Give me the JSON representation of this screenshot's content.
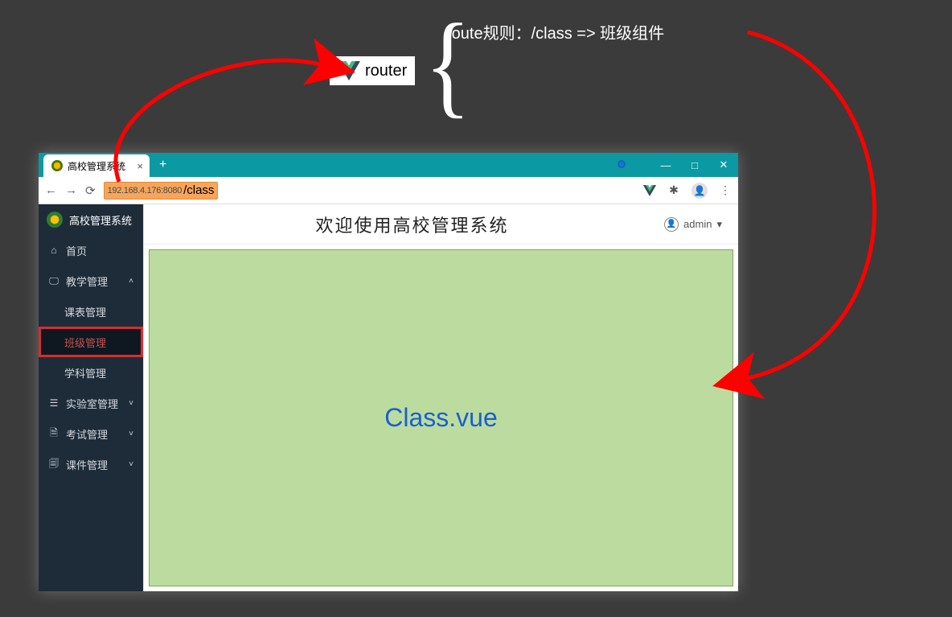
{
  "annotation": {
    "route_rule": "route规则：/class =>  班级组件",
    "router_label": "router"
  },
  "browser": {
    "tab_title": "高校管理系统",
    "new_tab": "+",
    "win_min": "—",
    "win_max": "□",
    "win_close": "✕",
    "url_host": "192.168.4.176:8080",
    "url_path": "/class",
    "menu_dots": "⋮"
  },
  "app": {
    "brand": "高校管理系统",
    "header_title": "欢迎使用高校管理系统",
    "user_name": "admin",
    "content_label": "Class.vue"
  },
  "sidebar": {
    "items": [
      {
        "icon": "⌂",
        "label": "首页",
        "chev": ""
      },
      {
        "icon": "🖵",
        "label": "教学管理",
        "chev": "˄"
      },
      {
        "icon": "",
        "label": "课表管理",
        "chev": "",
        "sub": true
      },
      {
        "icon": "",
        "label": "班级管理",
        "chev": "",
        "sub": true,
        "selected": true
      },
      {
        "icon": "",
        "label": "学科管理",
        "chev": "",
        "sub": true
      },
      {
        "icon": "☰",
        "label": "实验室管理",
        "chev": "˅"
      },
      {
        "icon": "🗎",
        "label": "考试管理",
        "chev": "˅"
      },
      {
        "icon": "🗐",
        "label": "课件管理",
        "chev": "˅"
      }
    ]
  }
}
